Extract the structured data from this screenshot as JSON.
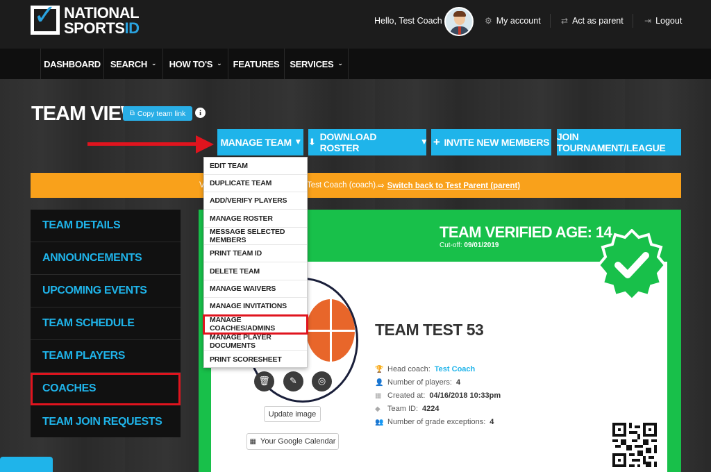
{
  "app": {
    "logo_line1": "NATIONAL",
    "logo_line2_a": "SPORTS",
    "logo_line2_b": "ID",
    "greeting": "Hello, Test Coach",
    "my_account": "My account",
    "act_as_parent": "Act as parent",
    "logout": "Logout"
  },
  "nav": {
    "items": [
      {
        "label": "DASHBOARD",
        "has_dropdown": false
      },
      {
        "label": "SEARCH",
        "has_dropdown": true
      },
      {
        "label": "HOW TO'S",
        "has_dropdown": true
      },
      {
        "label": "FEATURES",
        "has_dropdown": false
      },
      {
        "label": "SERVICES",
        "has_dropdown": true
      }
    ]
  },
  "page": {
    "title": "TEAM VIEW",
    "copy_link": "Copy team link"
  },
  "actions": {
    "manage_team": "MANAGE TEAM",
    "download_roster": "DOWNLOAD ROSTER",
    "invite": "INVITE NEW MEMBERS",
    "join": "JOIN TOURNAMENT/LEAGUE"
  },
  "banner": {
    "prefix": "V",
    "middle": "Test Coach (coach).",
    "link": "Switch back to Test Parent (parent)"
  },
  "sidebar": {
    "items": [
      {
        "label": "TEAM DETAILS"
      },
      {
        "label": "ANNOUNCEMENTS"
      },
      {
        "label": "UPCOMING EVENTS"
      },
      {
        "label": "TEAM SCHEDULE"
      },
      {
        "label": "TEAM PLAYERS"
      },
      {
        "label": "COACHES",
        "highlighted": true
      },
      {
        "label": "TEAM JOIN REQUESTS"
      }
    ]
  },
  "dropdown": {
    "items": [
      {
        "label": "EDIT TEAM"
      },
      {
        "label": "DUPLICATE TEAM"
      },
      {
        "label": "ADD/VERIFY PLAYERS"
      },
      {
        "label": "MANAGE ROSTER"
      },
      {
        "label": "MESSAGE SELECTED MEMBERS"
      },
      {
        "label": "PRINT TEAM ID"
      },
      {
        "label": "DELETE TEAM"
      },
      {
        "label": "MANAGE WAIVERS"
      },
      {
        "label": "MANAGE INVITATIONS"
      },
      {
        "label": "MANAGE COACHES/ADMINS",
        "highlighted": true
      },
      {
        "label": "MANAGE PLAYER DOCUMENTS"
      },
      {
        "label": "PRINT SCORESHEET"
      }
    ]
  },
  "team": {
    "verified_age": "TEAM VERIFIED AGE: 14",
    "cutoff_label": "Cut-off:",
    "cutoff_date": "09/01/2019",
    "name": "TEAM TEST 53",
    "update_image": "Update image",
    "google_calendar": "Your Google Calendar",
    "head_coach_label": "Head coach:",
    "head_coach": "Test Coach",
    "players_label": "Number of players:",
    "players": "4",
    "created_label": "Created at:",
    "created": "04/16/2018 10:33pm",
    "team_id_label": "Team ID:",
    "team_id": "4224",
    "grade_exc_label": "Number of grade exceptions:",
    "grade_exc": "4"
  },
  "colors": {
    "accent": "#1fb4ea",
    "highlight_red": "#e0141e",
    "banner_orange": "#f9a11b",
    "verified_green": "#18c04a"
  }
}
